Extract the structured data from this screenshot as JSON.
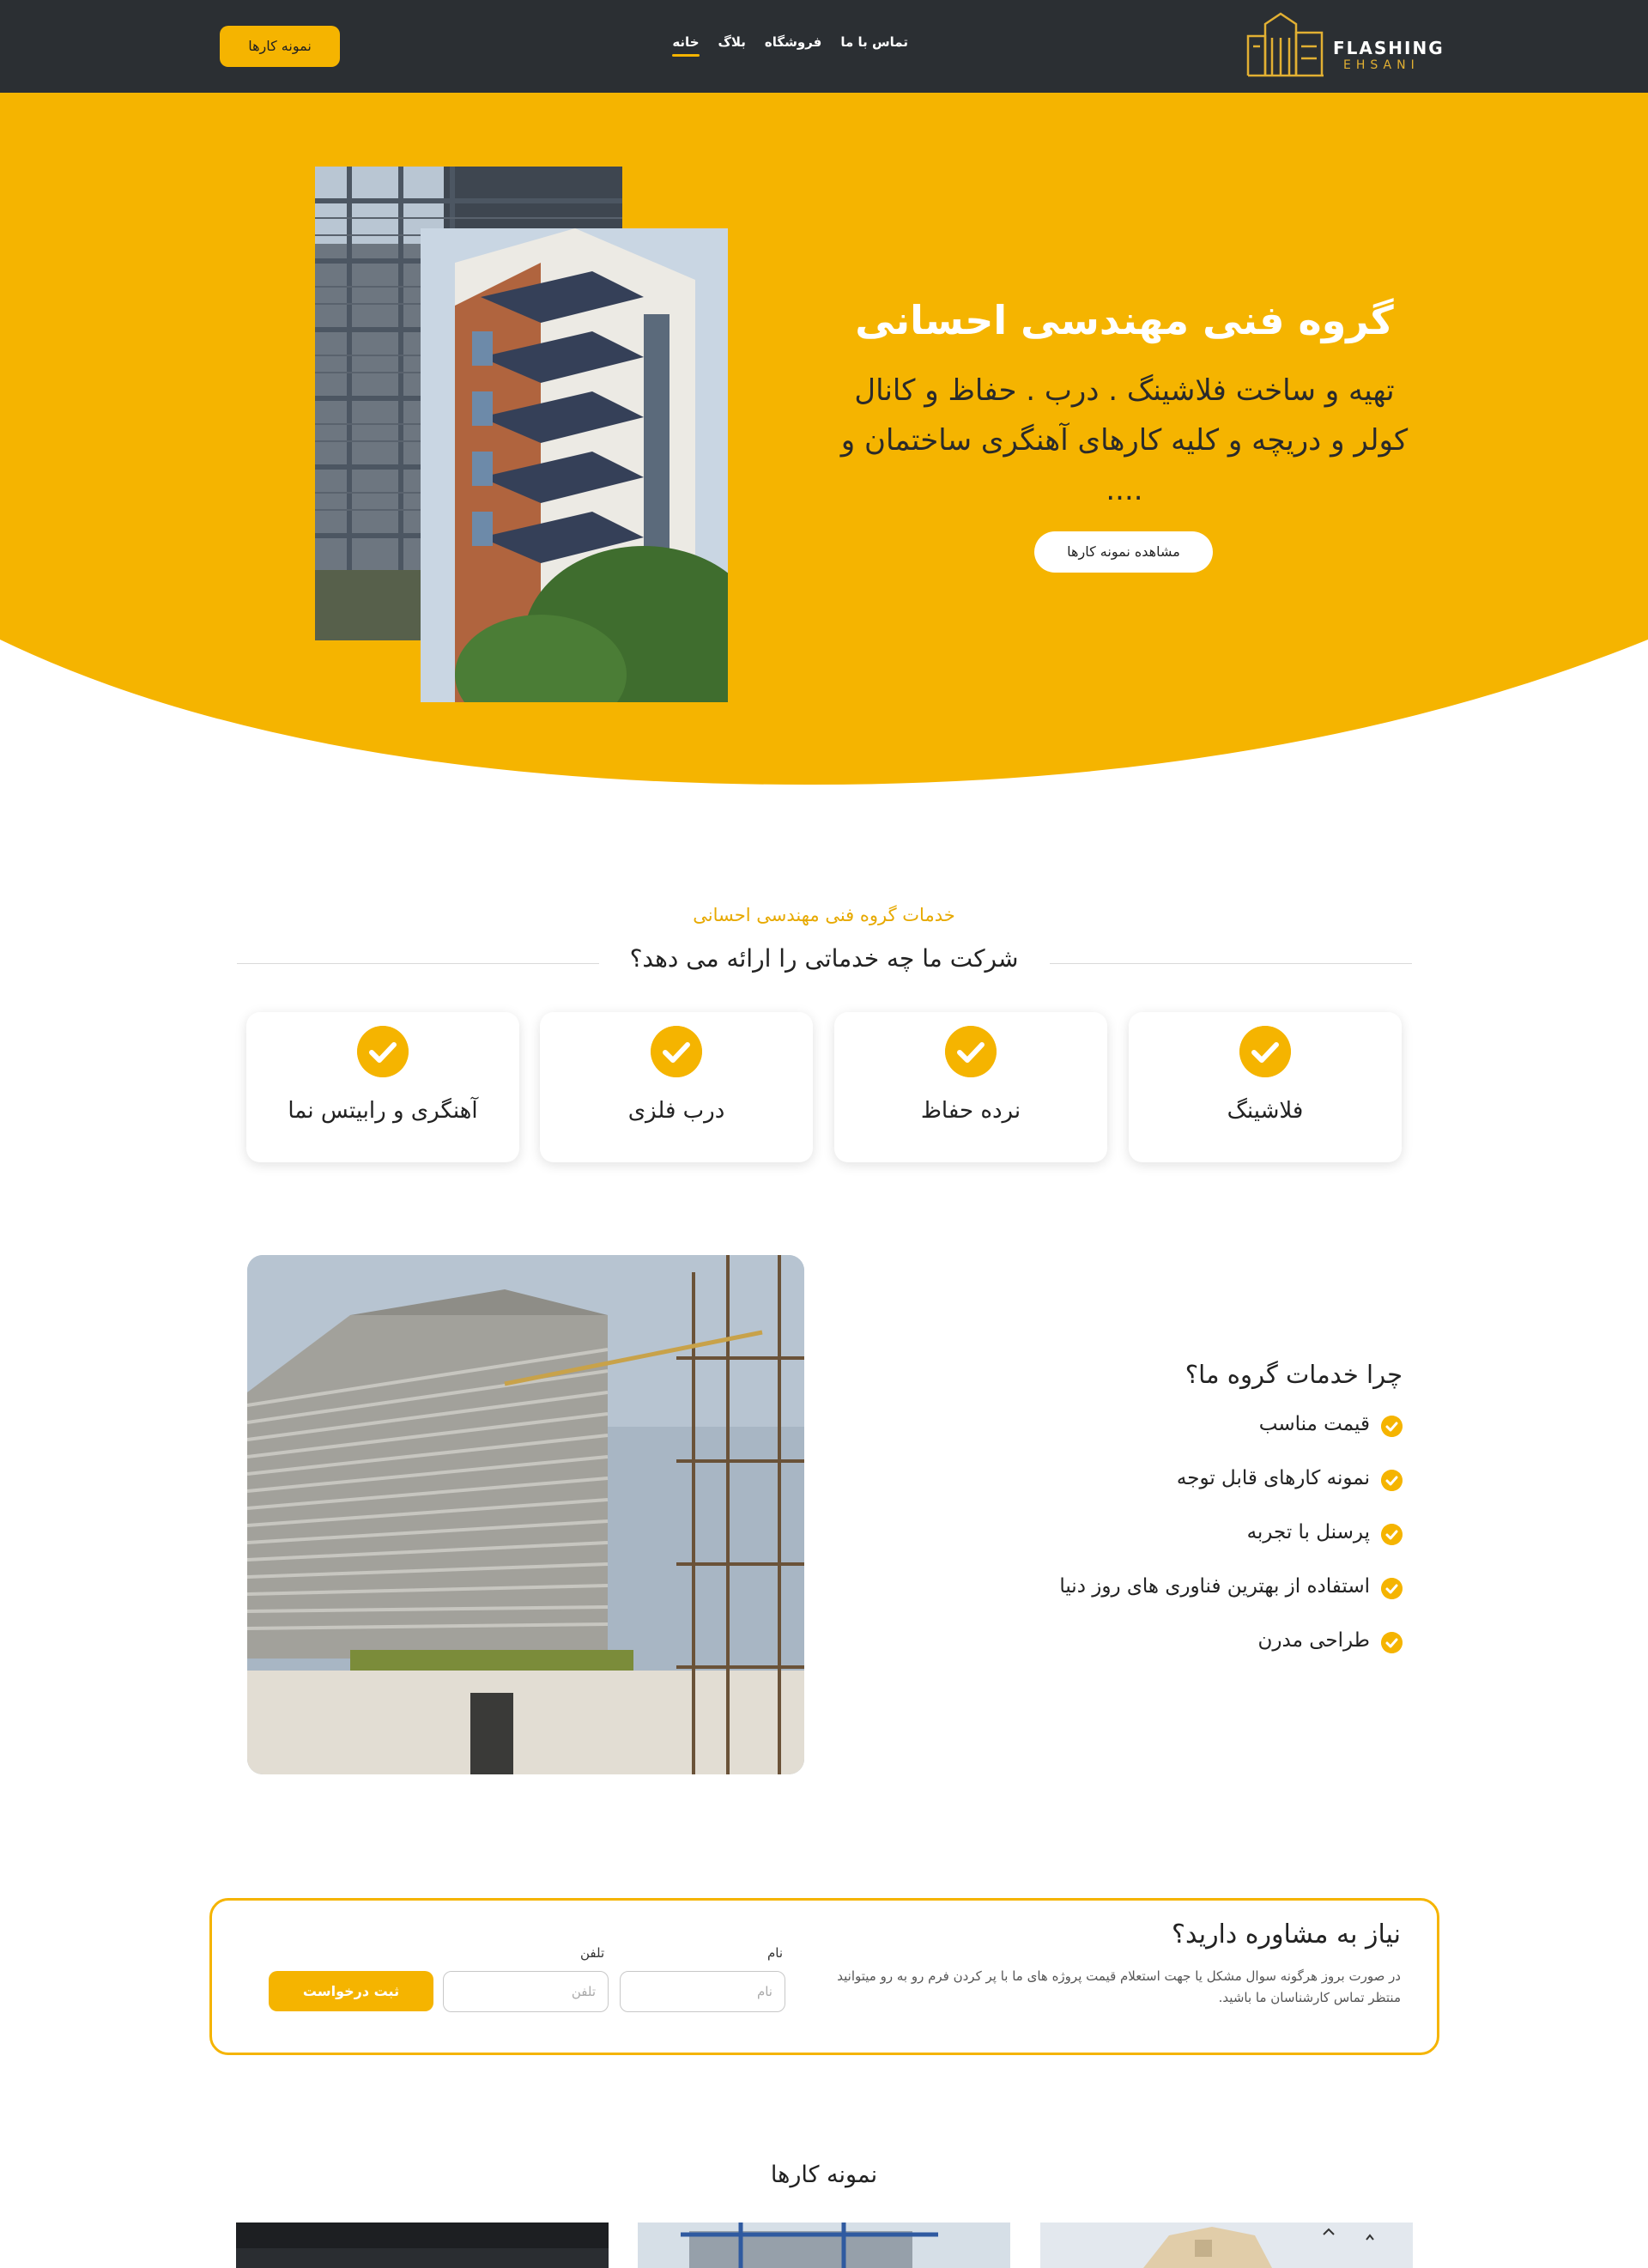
{
  "header": {
    "logo_title": "FLASHING",
    "logo_subtitle": "EHSANI",
    "nav": [
      {
        "label": "خانه",
        "active": true
      },
      {
        "label": "بلاگ",
        "active": false
      },
      {
        "label": "فروشگاه",
        "active": false
      },
      {
        "label": "تماس با ما",
        "active": false
      }
    ],
    "cta_label": "نمونه کارها"
  },
  "hero": {
    "title": "گروه فنی مهندسی احسانی",
    "description": "تهیه و ساخت فلاشینگ . درب . حفاظ و کانال کولر و دریچه و کلیه کارهای آهنگری ساختمان و ....",
    "button_label": "مشاهده نمونه کارها"
  },
  "services": {
    "kicker": "خدمات گروه فنی مهندسی احسانی",
    "heading": "شرکت ما چه خدماتی را ارائه می دهد؟",
    "items": [
      "فلاشینگ",
      "نرده حفاظ",
      "درب فلزی",
      "آهنگری و رابیتس نما"
    ]
  },
  "why": {
    "title": "چرا خدمات گروه ما؟",
    "items": [
      "قیمت مناسب",
      "نمونه کارهای قابل توجه",
      "پرسنل با تجربه",
      "استفاده از بهترین فناوری های روز دنیا",
      "طراحی مدرن"
    ]
  },
  "consult": {
    "title": "نیاز به مشاوره دارید؟",
    "text": "در صورت بروز هرگونه سوال مشکل یا جهت استعلام قیمت پروژه های ما با پر کردن فرم رو به رو میتوانید منتظر تماس کارشناسان ما باشید.",
    "name_label": "نام",
    "name_placeholder": "نام",
    "phone_label": "تلفن",
    "phone_placeholder": "تلفن",
    "submit_label": "ثبت درخواست"
  },
  "portfolio": {
    "title": "نمونه کارها"
  },
  "colors": {
    "accent": "#f5b400",
    "header_bg": "#2b2f33",
    "text": "#222222"
  }
}
